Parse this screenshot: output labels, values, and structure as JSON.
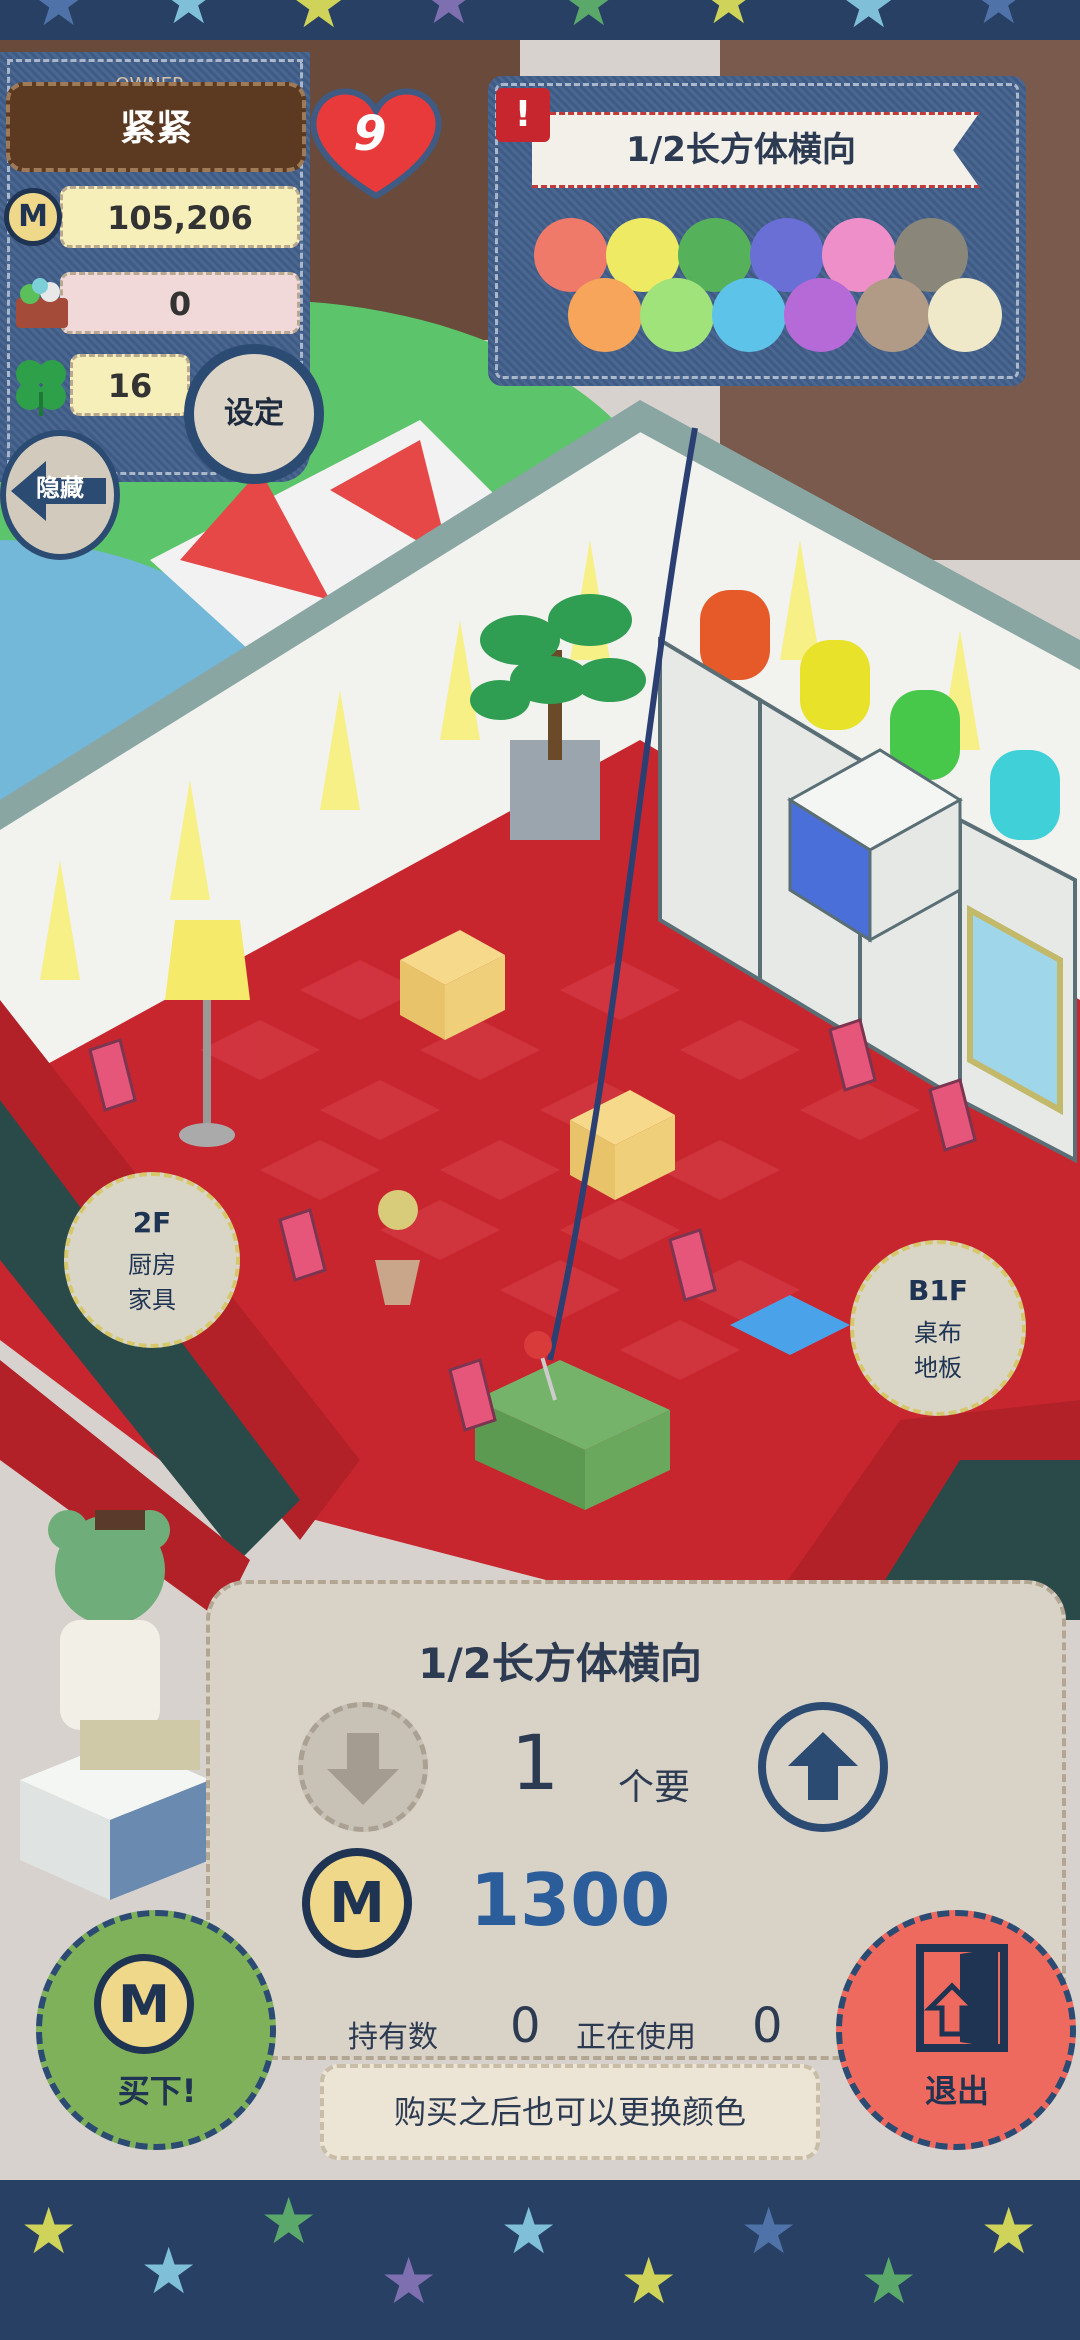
{
  "hud": {
    "owner_label": "OWNER",
    "player_name": "紧紧",
    "level": "9",
    "coins": "105,206",
    "basket": "0",
    "clover": "16",
    "settings_label": "设定",
    "hide_label": "隐藏",
    "coin_symbol": "M"
  },
  "color_picker": {
    "title": "1/2长方体横向",
    "alert_glyph": "!",
    "swatches_top": [
      "#f07a6a",
      "#eeea63",
      "#55b25b",
      "#6a6fd6",
      "#ef8fc9",
      "#8b867a"
    ],
    "swatches_bottom": [
      "#f6a55a",
      "#9fe37a",
      "#5ec3e8",
      "#b66ad8",
      "#b19b87",
      "#efe8c9"
    ]
  },
  "floor_signs": {
    "up": {
      "floor": "2F",
      "line1": "厨房",
      "line2": "家具"
    },
    "down": {
      "floor": "B1F",
      "line1": "桌布",
      "line2": "地板"
    }
  },
  "purchase": {
    "item_name": "1/2长方体横向",
    "quantity": "1",
    "quantity_unit": "个要",
    "price": "1300",
    "owned_label": "持有数",
    "owned_value": "0",
    "in_use_label": "正在使用",
    "in_use_value": "0",
    "hint": "购买之后也可以更换颜色",
    "buy_label": "买下!",
    "exit_label": "退出"
  },
  "colors": {
    "denim": "#3f5a83",
    "carpet": "#c8262f",
    "accent_text": "#2b5d9a"
  }
}
